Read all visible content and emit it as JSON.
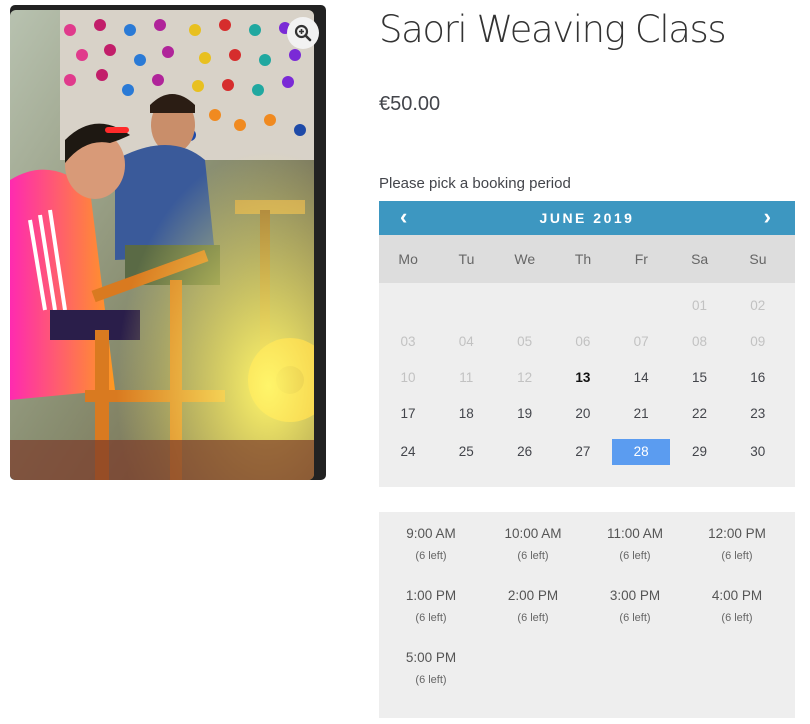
{
  "product": {
    "title": "Saori Weaving Class",
    "price": "€50.00",
    "image_icon": "zoom-in-icon"
  },
  "booking": {
    "pick_label": "Please pick a booking period",
    "calendar": {
      "month_label": "JUNE 2019",
      "prev_label": "‹",
      "next_label": "›",
      "weekdays": [
        "Mo",
        "Tu",
        "We",
        "Th",
        "Fr",
        "Sa",
        "Su"
      ],
      "rows": [
        [
          "",
          "",
          "",
          "",
          "",
          "01",
          "02"
        ],
        [
          "03",
          "04",
          "05",
          "06",
          "07",
          "08",
          "09"
        ],
        [
          "10",
          "11",
          "12",
          "13",
          "14",
          "15",
          "16"
        ],
        [
          "17",
          "18",
          "19",
          "20",
          "21",
          "22",
          "23"
        ],
        [
          "24",
          "25",
          "26",
          "27",
          "28",
          "29",
          "30"
        ]
      ],
      "today": "13",
      "selected": "28",
      "header_color": "#3d97c1",
      "selected_color": "#5b9cf0"
    },
    "time_slots": [
      {
        "time": "9:00 AM",
        "left": "(6 left)"
      },
      {
        "time": "10:00 AM",
        "left": "(6 left)"
      },
      {
        "time": "11:00 AM",
        "left": "(6 left)"
      },
      {
        "time": "12:00 PM",
        "left": "(6 left)"
      },
      {
        "time": "1:00 PM",
        "left": "(6 left)"
      },
      {
        "time": "2:00 PM",
        "left": "(6 left)"
      },
      {
        "time": "3:00 PM",
        "left": "(6 left)"
      },
      {
        "time": "4:00 PM",
        "left": "(6 left)"
      },
      {
        "time": "5:00 PM",
        "left": "(6 left)"
      }
    ]
  }
}
